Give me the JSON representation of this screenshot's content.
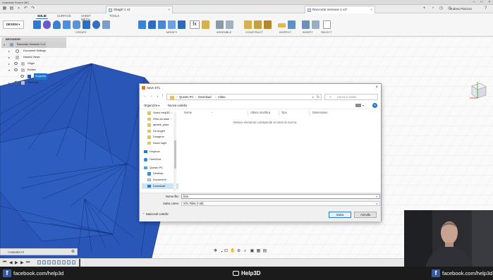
{
  "window": {
    "title": "Autodesk Fusion 360"
  },
  "tabs": {
    "documents": [
      {
        "label": "Sbagli! 1 v2",
        "active": false
      },
      {
        "label": "Raccordo Versione 1 v2*",
        "active": true
      }
    ],
    "user": "Andrea Piazzon"
  },
  "toolbar": {
    "workspace": "DESIGN",
    "mode_tabs": [
      "SOLID",
      "SURFACE",
      "SHEET METAL",
      "TOOLS"
    ],
    "active_mode": "SOLID",
    "groups": [
      "CREATE",
      "MODIFY",
      "ASSEMBLE",
      "CONSTRUCT",
      "INSPECT",
      "INSERT",
      "SELECT"
    ]
  },
  "browser": {
    "title": "BROWSER",
    "root": "Raccordo Versione 1 v2",
    "items": [
      "Document Settings",
      "Named Views",
      "Origin",
      "Bodies",
      "Supporto",
      "Sketches"
    ]
  },
  "dialog": {
    "title": "Save STL",
    "breadcrumb": [
      "Questo PC",
      "Download",
      "Video"
    ],
    "search_placeholder": "Cerca in Video",
    "organize": "Organizza",
    "new_folder": "Nuova cartella",
    "nav_items": [
      "Video Help3D",
      "Files da stam",
      "apotek_piraz",
      "De Angeli",
      "Dungeon",
      "Nuovi loghi",
      "Dropbox",
      "OneDrive",
      "Questo PC",
      "Desktop",
      "Documenti",
      "Download"
    ],
    "selected_nav": "Download",
    "columns": [
      "Nome",
      "Ultima modifica",
      "Tipo",
      "Dimensione"
    ],
    "empty_message": "Nessun elemento corrisponde ai criteri di ricerca.",
    "filename_label": "Nome file:",
    "filename_value": "tree",
    "save_as_label": "Salva come:",
    "save_as_value": "STL Files (*.stl)",
    "hide_folders": "Nascondi cartelle",
    "save_button": "Salva",
    "cancel_button": "Annulla"
  },
  "comments": {
    "label": "COMMENTS"
  },
  "footer": {
    "left_link": "facebook.com/help3d",
    "brand": "Help3D",
    "right_link": "facebook.com/help3d"
  },
  "colors": {
    "accent": "#1f73c8",
    "model_blue": "#2356b8",
    "facebook": "#3b5998"
  }
}
